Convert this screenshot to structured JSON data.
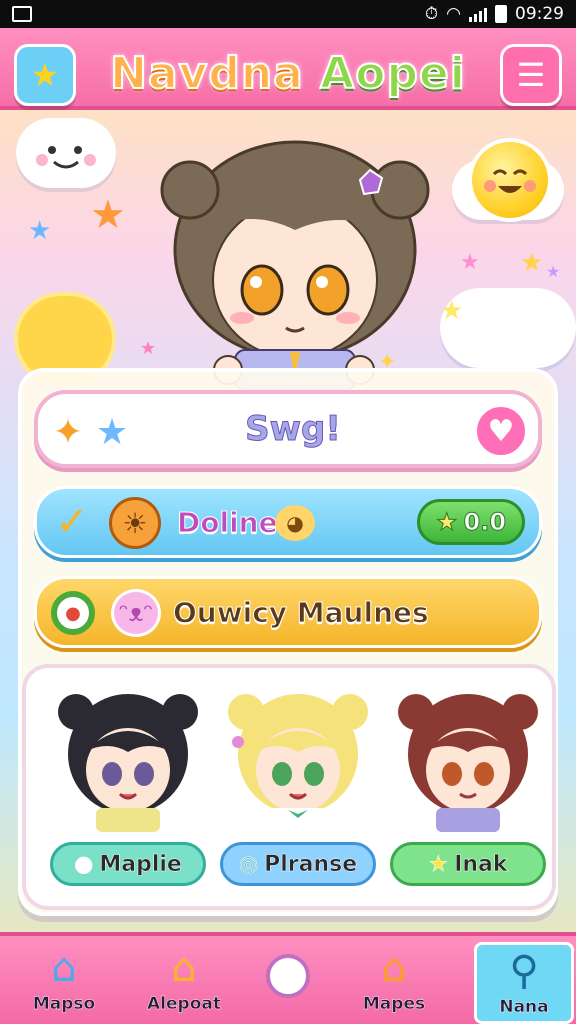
{
  "statusbar": {
    "time": "09:29"
  },
  "header": {
    "title_part1": "Navdna",
    "title_part2": "Aopei",
    "left_button": "star-icon",
    "right_button": "menu-icon"
  },
  "rows": {
    "say": {
      "label": "Swg!"
    },
    "online": {
      "label": "Doline",
      "score": "0.0"
    },
    "daily": {
      "label": "Ouwicy Maulnes"
    }
  },
  "characters": [
    {
      "name": "Maplie",
      "hair": "#2b2a33",
      "eyes": "#6a5a9a",
      "pill": "#7ae0c8",
      "pill_border": "#2fb09a"
    },
    {
      "name": "Plranse",
      "hair": "#f6e27a",
      "eyes": "#4aa55a",
      "pill": "#8fd2ff",
      "pill_border": "#3d94d6"
    },
    {
      "name": "Inak",
      "hair": "#8a3a32",
      "eyes": "#c0592a",
      "pill": "#7fe28c",
      "pill_border": "#3aaa4a"
    }
  ],
  "nav": [
    {
      "label": "Mapso",
      "icon": "home-icon"
    },
    {
      "label": "Alepoat",
      "icon": "house-icon"
    },
    {
      "label": "",
      "icon": "circle-button-icon"
    },
    {
      "label": "Mapes",
      "icon": "house-icon"
    },
    {
      "label": "Nana",
      "icon": "search-icon"
    }
  ],
  "colors": {
    "accent_pink": "#f66ea8",
    "accent_blue": "#64c7f2",
    "accent_yellow": "#f5b52a"
  }
}
